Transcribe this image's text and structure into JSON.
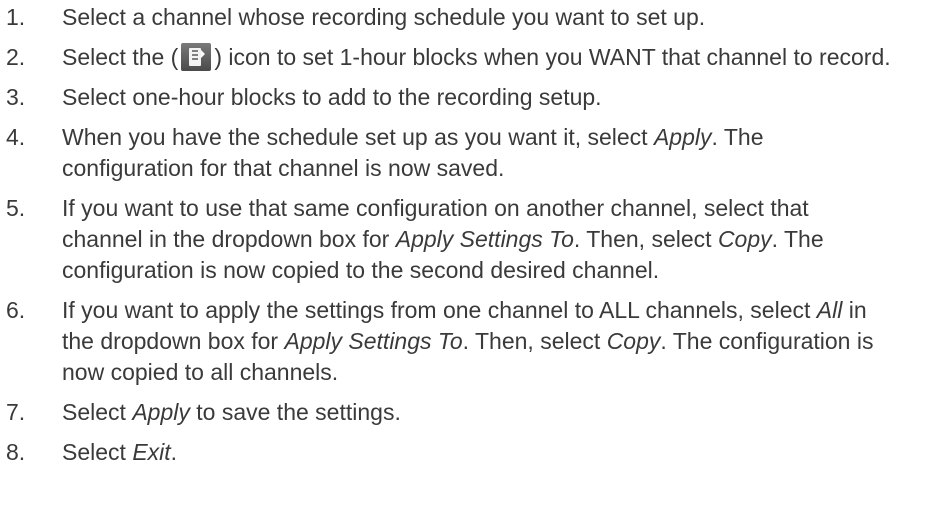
{
  "steps": [
    {
      "number": "1.",
      "text": "Select a channel whose recording schedule you want to set up."
    },
    {
      "number": "2.",
      "text_before": "Select the (",
      "icon": "schedule-block-icon",
      "text_after": ") icon to set 1-hour blocks when you WANT that channel to record."
    },
    {
      "number": "3.",
      "text": "Select one-hour blocks to add to the recording setup."
    },
    {
      "number": "4.",
      "parts": [
        "When you have the schedule set up as you want it, select ",
        "Apply",
        ". The configuration for that channel is now saved."
      ]
    },
    {
      "number": "5.",
      "parts": [
        "If you want to use that same configuration on another channel, select that channel in the dropdown box for ",
        "Apply Settings To",
        ". Then, select ",
        "Copy",
        ". The configuration is now copied to the second desired channel."
      ]
    },
    {
      "number": "6.",
      "parts": [
        "If you want to apply the settings from one channel to ALL channels, select ",
        "All",
        " in the dropdown box for ",
        "Apply Settings To",
        ". Then, select ",
        "Copy",
        ". The configuration is now copied to all channels."
      ]
    },
    {
      "number": "7.",
      "parts": [
        "Select ",
        "Apply",
        " to save the settings."
      ]
    },
    {
      "number": "8.",
      "parts": [
        "Select ",
        "Exit",
        "."
      ]
    }
  ],
  "colors": {
    "text": "#3a3a3a",
    "icon_background": "#5a5a5a",
    "icon_foreground": "#ffffff"
  }
}
